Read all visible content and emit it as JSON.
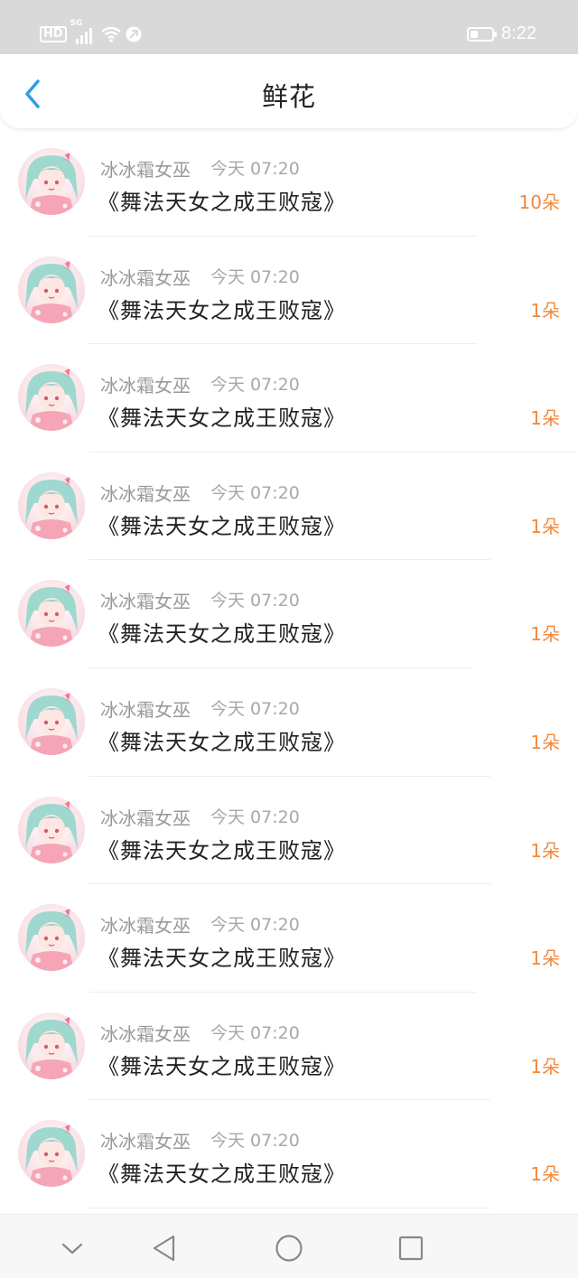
{
  "status_bar": {
    "network_hd": "HD",
    "network_type": "5G",
    "time": "8:22",
    "battery_level": 0.35
  },
  "header": {
    "title": "鲜花",
    "back_icon": "chevron-left-icon"
  },
  "colors": {
    "accent_blue": "#2b9fe6",
    "count_orange": "#f2883a"
  },
  "flowers": [
    {
      "user": "冰冰霜女巫",
      "time": "今天 07:20",
      "book": "《舞法天女之成王败寇》",
      "count": "10朵"
    },
    {
      "user": "冰冰霜女巫",
      "time": "今天 07:20",
      "book": "《舞法天女之成王败寇》",
      "count": "1朵"
    },
    {
      "user": "冰冰霜女巫",
      "time": "今天 07:20",
      "book": "《舞法天女之成王败寇》",
      "count": "1朵"
    },
    {
      "user": "冰冰霜女巫",
      "time": "今天 07:20",
      "book": "《舞法天女之成王败寇》",
      "count": "1朵"
    },
    {
      "user": "冰冰霜女巫",
      "time": "今天 07:20",
      "book": "《舞法天女之成王败寇》",
      "count": "1朵"
    },
    {
      "user": "冰冰霜女巫",
      "time": "今天 07:20",
      "book": "《舞法天女之成王败寇》",
      "count": "1朵"
    },
    {
      "user": "冰冰霜女巫",
      "time": "今天 07:20",
      "book": "《舞法天女之成王败寇》",
      "count": "1朵"
    },
    {
      "user": "冰冰霜女巫",
      "time": "今天 07:20",
      "book": "《舞法天女之成王败寇》",
      "count": "1朵"
    },
    {
      "user": "冰冰霜女巫",
      "time": "今天 07:20",
      "book": "《舞法天女之成王败寇》",
      "count": "1朵"
    },
    {
      "user": "冰冰霜女巫",
      "time": "今天 07:20",
      "book": "《舞法天女之成王败寇》",
      "count": "1朵"
    }
  ],
  "nav_bar": {
    "buttons": [
      "chevron-down-icon",
      "back-triangle-icon",
      "home-circle-icon",
      "recents-square-icon"
    ]
  }
}
